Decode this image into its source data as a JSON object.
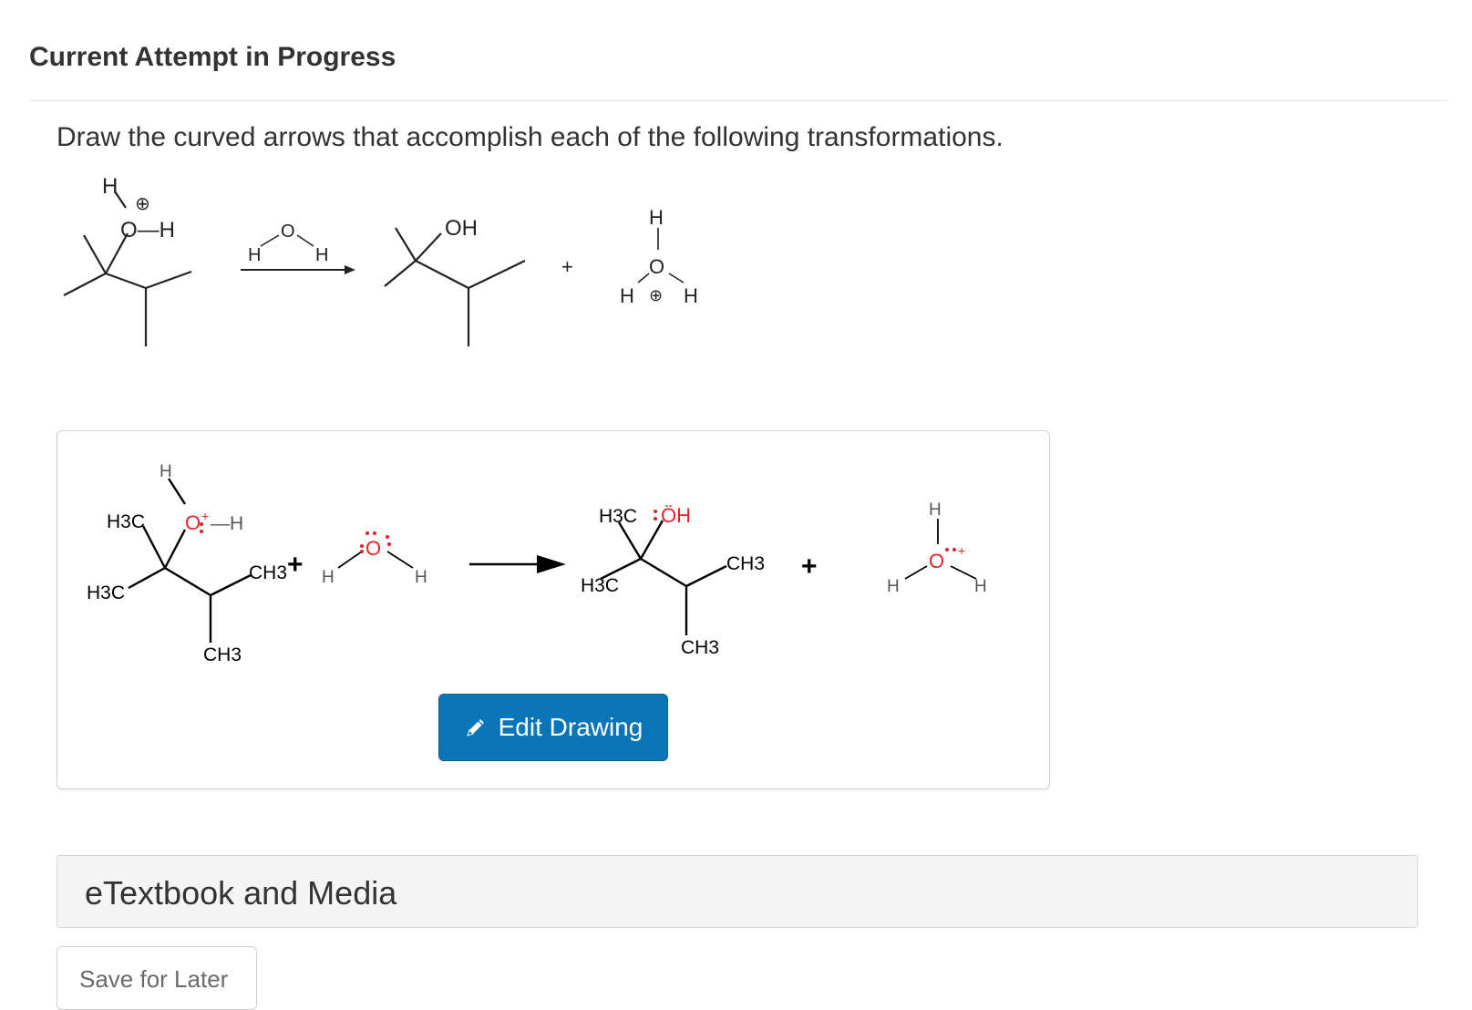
{
  "header": {
    "title": "Current Attempt in Progress"
  },
  "question": {
    "prompt": "Draw the curved arrows that accomplish each of the following transformations."
  },
  "reaction": {
    "reactant_atoms": {
      "h_top": "H",
      "charge": "⊕",
      "o_h": "O—H"
    },
    "reagent": {
      "h_left": "H",
      "o": "O",
      "h_right": "H"
    },
    "product_alcohol": {
      "oh": "OH"
    },
    "plus": "+",
    "product_hydronium": {
      "h_top": "H",
      "o": "O",
      "h_left": "H",
      "h_right": "H",
      "charge": "⊕"
    }
  },
  "drawing": {
    "reactant": {
      "h_top": "H",
      "h3c_upper": "H3C",
      "h3c_lower": "H3C",
      "o": "O",
      "plus_charge": "+",
      "h_right": "—H",
      "ch3_right": "CH3",
      "ch3_bottom": "CH3"
    },
    "plus_1": "+",
    "water": {
      "h_left": "H",
      "o": "O",
      "h_right": "H"
    },
    "product": {
      "h3c_upper": "H3C",
      "h3c_lower": "H3C",
      "oh": "ÖH",
      "ch3_right": "CH3",
      "ch3_bottom": "CH3"
    },
    "plus_2": "+",
    "hydronium": {
      "h_top": "H",
      "o": "O",
      "charge": "+",
      "h_left": "H",
      "h_right": "H"
    },
    "colors": {
      "oxygen": "#e0242a",
      "bond": "#000000",
      "hydrogen": "#555555"
    },
    "edit_button_label": "Edit Drawing"
  },
  "etextbook": {
    "label": "eTextbook and Media"
  },
  "footer": {
    "save_label": "Save for Later"
  }
}
